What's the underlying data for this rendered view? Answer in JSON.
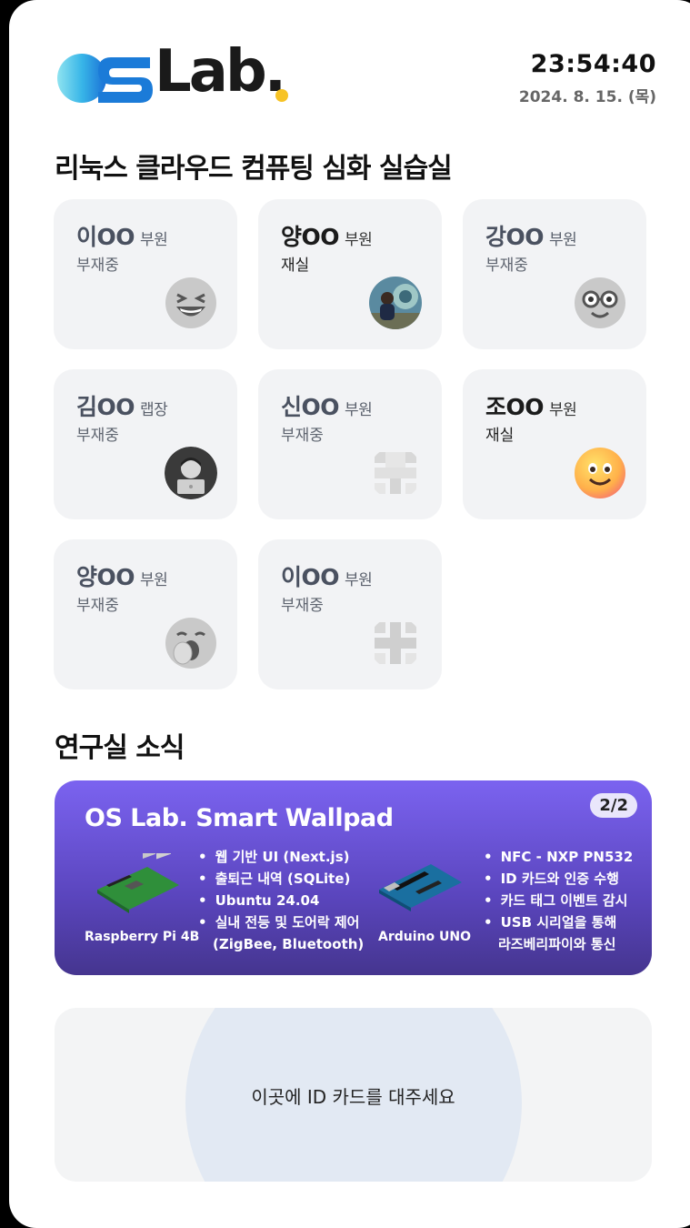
{
  "header": {
    "logo_text": "Lab.",
    "logo_alt": "OSLab.",
    "time": "23:54:40",
    "date": "2024. 8. 15. (목)"
  },
  "lab_section": {
    "title": "리눅스 클라우드 컴퓨팅 심화 실습실",
    "members": [
      {
        "name": "이OO",
        "role": "부원",
        "status": "부재중",
        "avatar": "grinning-squint-emoji"
      },
      {
        "name": "양OO",
        "role": "부원",
        "status": "재실",
        "avatar": "photo-avatar"
      },
      {
        "name": "강OO",
        "role": "부원",
        "status": "부재중",
        "avatar": "nerd-glasses-emoji"
      },
      {
        "name": "김OO",
        "role": "랩장",
        "status": "부재중",
        "avatar": "laptop-person-avatar"
      },
      {
        "name": "신OO",
        "role": "부원",
        "status": "부재중",
        "avatar": "identicon-avatar"
      },
      {
        "name": "조OO",
        "role": "부원",
        "status": "재실",
        "avatar": "smiling-emoji"
      },
      {
        "name": "양OO",
        "role": "부원",
        "status": "부재중",
        "avatar": "yawning-emoji"
      },
      {
        "name": "이OO",
        "role": "부원",
        "status": "부재중",
        "avatar": "identicon-avatar"
      }
    ]
  },
  "news_section": {
    "title": "연구실 소식",
    "card": {
      "title": "OS Lab.  Smart Wallpad",
      "pager": "2/2",
      "left_device": "Raspberry Pi 4B",
      "left_features": [
        "웹 기반 UI (Next.js)",
        "출퇴근 내역 (SQLite)",
        "Ubuntu 24.04",
        "실내 전등 및 도어락 제어",
        "(ZigBee, Bluetooth)"
      ],
      "right_device": "Arduino UNO",
      "right_features": [
        "NFC - NXP PN532",
        "ID 카드와 인증 수행",
        "카드 태그 이벤트 감시",
        "USB 시리얼을 통해",
        "라즈베리파이와 통신"
      ]
    }
  },
  "tap_area": {
    "prompt": "이곳에 ID 카드를 대주세요"
  },
  "colors": {
    "news_gradient_top": "#7b63f0",
    "news_gradient_bottom": "#45358f",
    "logo_dot": "#f7c325",
    "card_bg": "#f2f3f5",
    "tap_circle": "#e2e9f3"
  }
}
